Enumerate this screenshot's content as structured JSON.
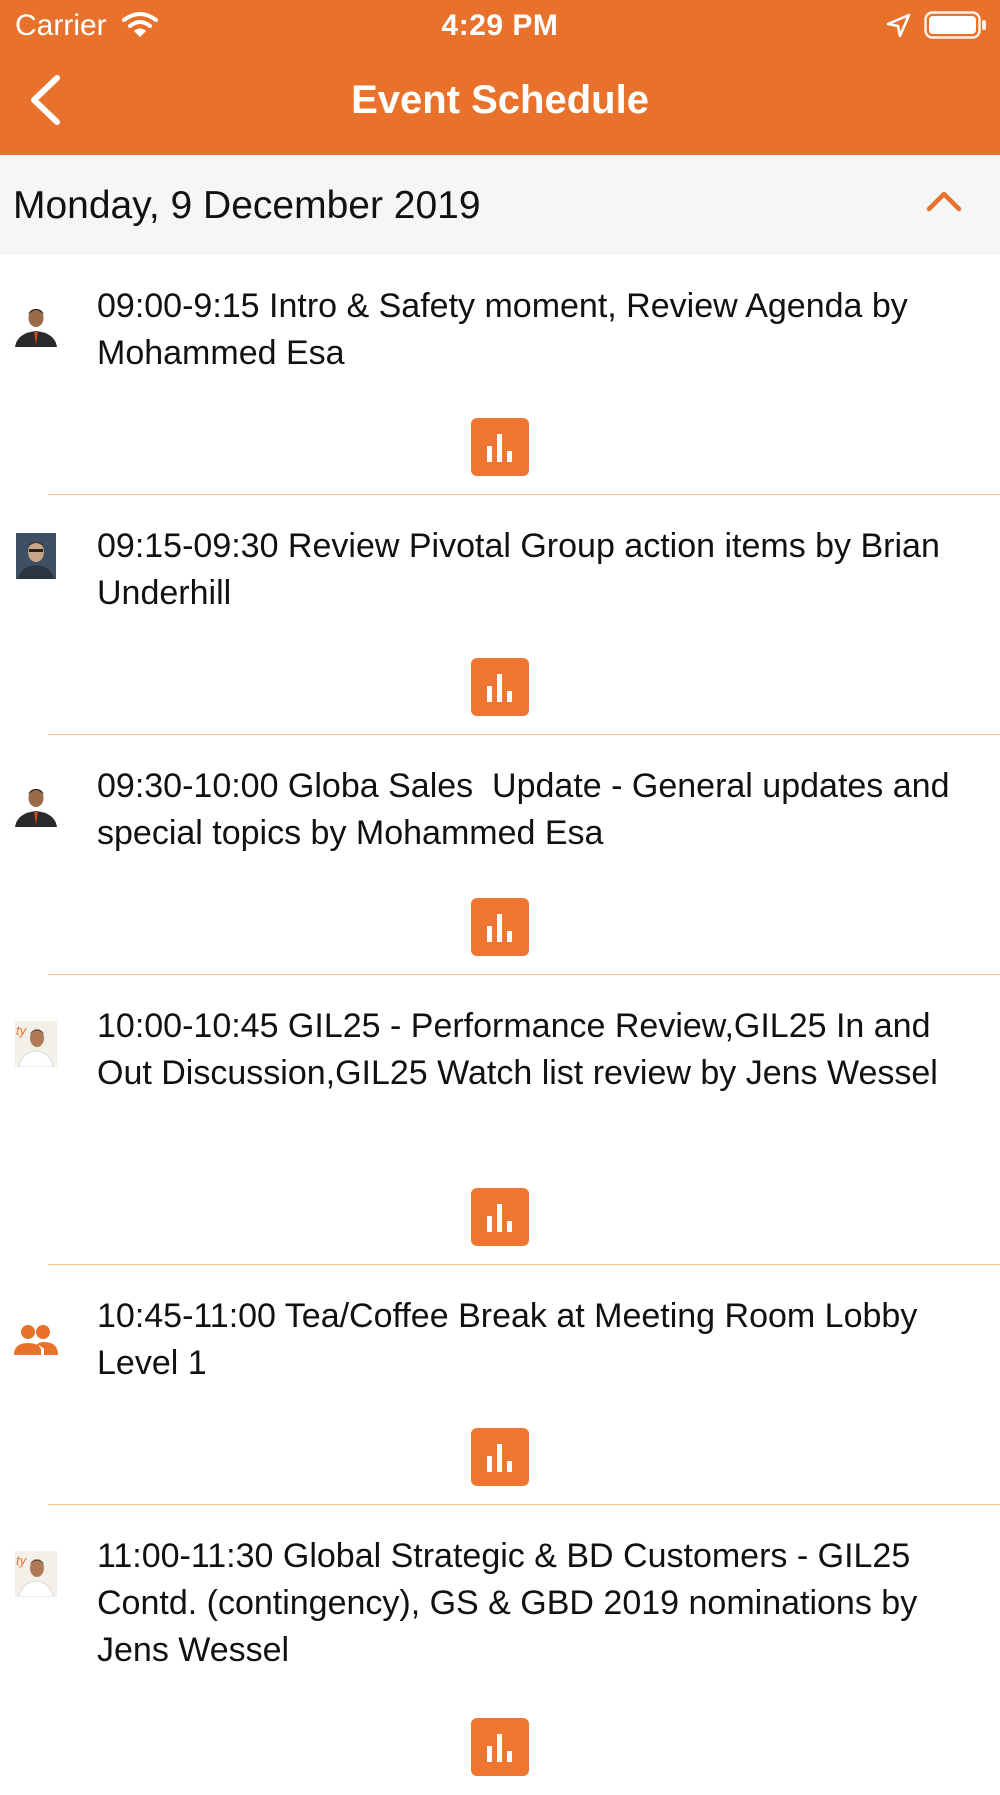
{
  "status_bar": {
    "carrier": "Carrier",
    "time": "4:29 PM",
    "icons": [
      "wifi-icon",
      "location-arrow-icon",
      "battery-icon"
    ]
  },
  "nav": {
    "title": "Event Schedule",
    "back_icon": "chevron-left-icon"
  },
  "date_header": {
    "label": "Monday, 9 December 2019",
    "toggle_icon": "chevron-up-icon"
  },
  "sessions": [
    {
      "text": "09:00-9:15 Intro & Safety moment, Review Agenda by Mohammed Esa",
      "avatar": "speaker-photo",
      "action_icon": "poll-icon"
    },
    {
      "text": "09:15-09:30 Review Pivotal Group action items by Brian Underhill",
      "avatar": "speaker-photo",
      "action_icon": "poll-icon"
    },
    {
      "text": "09:30-10:00 Globa Sales  Update - General updates and special topics by Mohammed Esa",
      "avatar": "speaker-photo",
      "action_icon": "poll-icon"
    },
    {
      "text": "10:00-10:45 GIL25 - Performance Review,GIL25 In and Out Discussion,GIL25 Watch list review by Jens Wessel",
      "avatar": "speaker-photo",
      "action_icon": "poll-icon"
    },
    {
      "text": "10:45-11:00 Tea/Coffee Break at Meeting Room Lobby Level 1",
      "avatar": "group-icon",
      "action_icon": "poll-icon"
    },
    {
      "text": "11:00-11:30 Global Strategic & BD Customers - GIL25 Contd. (contingency), GS & GBD 2019 nominations by Jens Wessel",
      "avatar": "speaker-photo",
      "action_icon": "poll-icon"
    }
  ],
  "colors": {
    "brand": "#e8722c",
    "poll_button": "#ee7631",
    "divider": "#f3c08a",
    "date_header_bg": "#f6f6f6"
  }
}
